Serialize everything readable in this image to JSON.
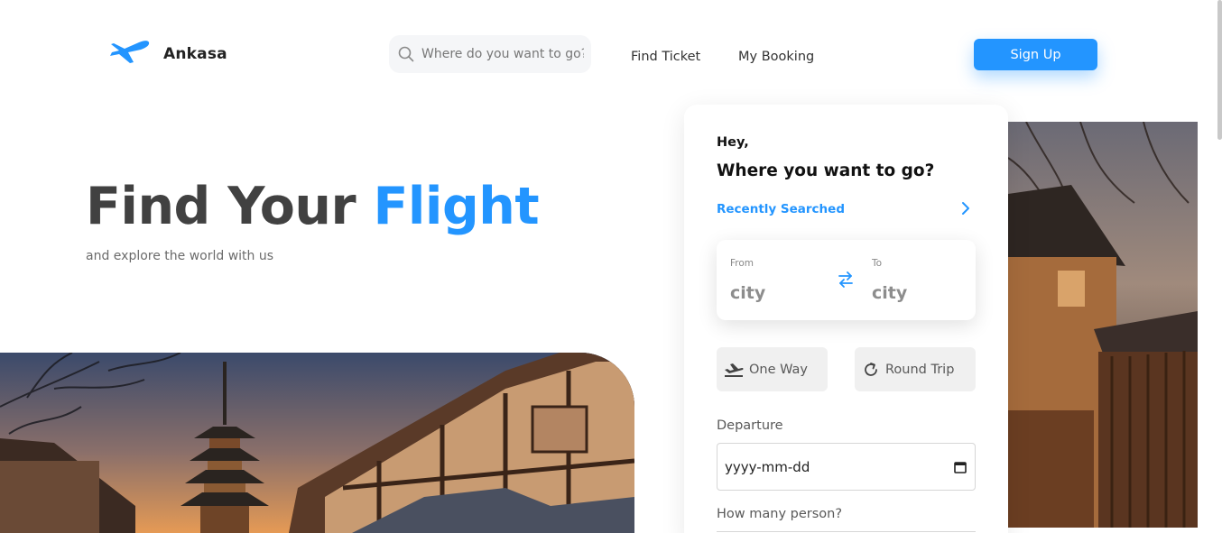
{
  "brand": {
    "name": "Ankasa",
    "color": "#2395ff"
  },
  "header": {
    "search_placeholder": "Where do you want to go?",
    "nav": [
      "Find Ticket",
      "My Booking"
    ],
    "signup_label": "Sign Up"
  },
  "hero": {
    "title_main": "Find Your ",
    "title_accent": "Flight",
    "subtitle": "and explore the world with us"
  },
  "card": {
    "greeting": "Hey,",
    "question": "Where you want to go?",
    "recent_label": "Recently Searched",
    "from_label": "From",
    "from_value": "city",
    "to_label": "To",
    "to_value": "city",
    "one_way_label": "One Way",
    "round_trip_label": "Round Trip",
    "departure_label": "Departure",
    "departure_value": "yyyy-mm-dd",
    "persons_label": "How many person?"
  },
  "icons": {
    "logo": "plane-logo-icon",
    "search": "search-icon",
    "chevron": "chevron-right-icon",
    "swap": "swap-arrows-icon",
    "one_way": "plane-departure-icon",
    "round_trip": "refresh-icon",
    "calendar": "calendar-icon"
  }
}
